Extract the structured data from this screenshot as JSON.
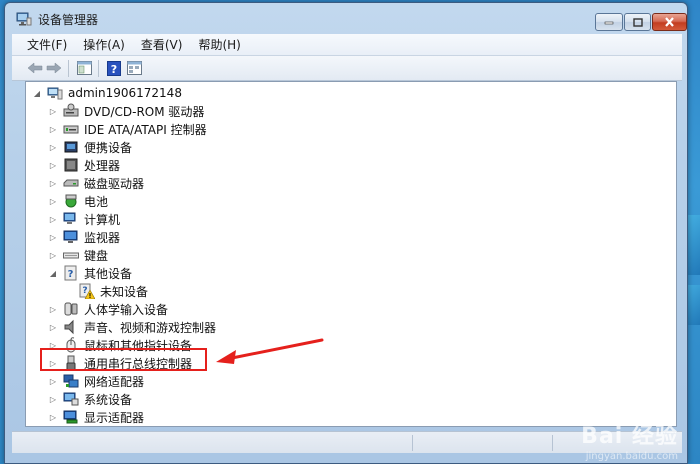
{
  "window": {
    "title": "设备管理器"
  },
  "menu": [
    "文件(F)",
    "操作(A)",
    "查看(V)",
    "帮助(H)"
  ],
  "toolbar": {
    "buttons": [
      "back-icon",
      "forward-icon",
      "properties-icon",
      "help-icon",
      "view-icon"
    ]
  },
  "tree": {
    "root": "admin1906172148",
    "items": [
      {
        "label": "DVD/CD-ROM 驱动器",
        "icon": "dvd-drive-icon",
        "expanded": false
      },
      {
        "label": "IDE ATA/ATAPI 控制器",
        "icon": "ide-controller-icon",
        "expanded": false
      },
      {
        "label": "便携设备",
        "icon": "portable-device-icon",
        "expanded": false
      },
      {
        "label": "处理器",
        "icon": "processor-icon",
        "expanded": false
      },
      {
        "label": "磁盘驱动器",
        "icon": "disk-drive-icon",
        "expanded": false
      },
      {
        "label": "电池",
        "icon": "battery-icon",
        "expanded": false
      },
      {
        "label": "计算机",
        "icon": "computer-icon",
        "expanded": false
      },
      {
        "label": "监视器",
        "icon": "monitor-icon",
        "expanded": false
      },
      {
        "label": "键盘",
        "icon": "keyboard-icon",
        "expanded": false
      },
      {
        "label": "其他设备",
        "icon": "other-devices-icon",
        "expanded": true
      },
      {
        "label": "未知设备",
        "icon": "unknown-device-warning-icon",
        "child": true
      },
      {
        "label": "人体学输入设备",
        "icon": "hid-icon",
        "expanded": false
      },
      {
        "label": "声音、视频和游戏控制器",
        "icon": "sound-icon",
        "expanded": false
      },
      {
        "label": "鼠标和其他指针设备",
        "icon": "mouse-icon",
        "expanded": false
      },
      {
        "label": "通用串行总线控制器",
        "icon": "usb-icon",
        "expanded": false,
        "highlighted": true
      },
      {
        "label": "网络适配器",
        "icon": "network-adapter-icon",
        "expanded": false
      },
      {
        "label": "系统设备",
        "icon": "system-device-icon",
        "expanded": false
      },
      {
        "label": "显示适配器",
        "icon": "display-adapter-icon",
        "expanded": false
      }
    ]
  },
  "annotation": {
    "color": "#e5201c"
  },
  "watermark": {
    "text": "Bai 经验",
    "sub": "jingyan.baidu.com"
  }
}
